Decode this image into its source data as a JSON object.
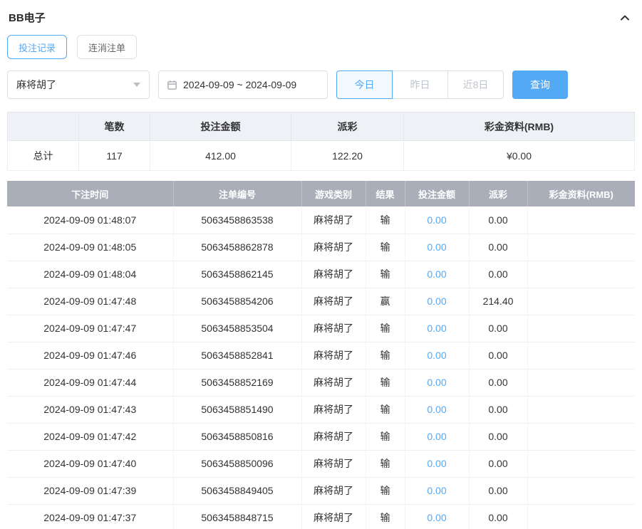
{
  "header": {
    "title": "BB电子"
  },
  "tabs": [
    {
      "label": "投注记录",
      "active": true
    },
    {
      "label": "连消注单",
      "active": false
    }
  ],
  "filters": {
    "game_select": {
      "value": "麻将胡了"
    },
    "date_range": {
      "value": "2024-09-09 ~ 2024-09-09"
    },
    "quick_buttons": [
      {
        "label": "今日",
        "active": true
      },
      {
        "label": "昨日",
        "active": false
      },
      {
        "label": "近8日",
        "active": false
      }
    ],
    "search_label": "查询"
  },
  "summary": {
    "headers": [
      "",
      "笔数",
      "投注金额",
      "派彩",
      "彩金资料(RMB)"
    ],
    "row": {
      "label": "总计",
      "count": "117",
      "bet_amount": "412.00",
      "payout": "122.20",
      "jackpot": "¥0.00"
    }
  },
  "table": {
    "headers": [
      "下注时间",
      "注单编号",
      "游戏类别",
      "结果",
      "投注金额",
      "派彩",
      "彩金资料(RMB)"
    ],
    "rows": [
      {
        "time": "2024-09-09 01:48:07",
        "order_no": "5063458863538",
        "game": "麻将胡了",
        "result": "输",
        "bet": "0.00",
        "payout": "0.00",
        "jackpot": ""
      },
      {
        "time": "2024-09-09 01:48:05",
        "order_no": "5063458862878",
        "game": "麻将胡了",
        "result": "输",
        "bet": "0.00",
        "payout": "0.00",
        "jackpot": ""
      },
      {
        "time": "2024-09-09 01:48:04",
        "order_no": "5063458862145",
        "game": "麻将胡了",
        "result": "输",
        "bet": "0.00",
        "payout": "0.00",
        "jackpot": ""
      },
      {
        "time": "2024-09-09 01:47:48",
        "order_no": "5063458854206",
        "game": "麻将胡了",
        "result": "赢",
        "bet": "0.00",
        "payout": "214.40",
        "jackpot": ""
      },
      {
        "time": "2024-09-09 01:47:47",
        "order_no": "5063458853504",
        "game": "麻将胡了",
        "result": "输",
        "bet": "0.00",
        "payout": "0.00",
        "jackpot": ""
      },
      {
        "time": "2024-09-09 01:47:46",
        "order_no": "5063458852841",
        "game": "麻将胡了",
        "result": "输",
        "bet": "0.00",
        "payout": "0.00",
        "jackpot": ""
      },
      {
        "time": "2024-09-09 01:47:44",
        "order_no": "5063458852169",
        "game": "麻将胡了",
        "result": "输",
        "bet": "0.00",
        "payout": "0.00",
        "jackpot": ""
      },
      {
        "time": "2024-09-09 01:47:43",
        "order_no": "5063458851490",
        "game": "麻将胡了",
        "result": "输",
        "bet": "0.00",
        "payout": "0.00",
        "jackpot": ""
      },
      {
        "time": "2024-09-09 01:47:42",
        "order_no": "5063458850816",
        "game": "麻将胡了",
        "result": "输",
        "bet": "0.00",
        "payout": "0.00",
        "jackpot": ""
      },
      {
        "time": "2024-09-09 01:47:40",
        "order_no": "5063458850096",
        "game": "麻将胡了",
        "result": "输",
        "bet": "0.00",
        "payout": "0.00",
        "jackpot": ""
      },
      {
        "time": "2024-09-09 01:47:39",
        "order_no": "5063458849405",
        "game": "麻将胡了",
        "result": "输",
        "bet": "0.00",
        "payout": "0.00",
        "jackpot": ""
      },
      {
        "time": "2024-09-09 01:47:37",
        "order_no": "5063458848715",
        "game": "麻将胡了",
        "result": "输",
        "bet": "0.00",
        "payout": "0.00",
        "jackpot": ""
      }
    ]
  },
  "colors": {
    "accent": "#54a9f4",
    "table_header_bg": "#a9aeb9",
    "summary_header_bg": "#eef1f5",
    "link": "#54a9f4"
  }
}
